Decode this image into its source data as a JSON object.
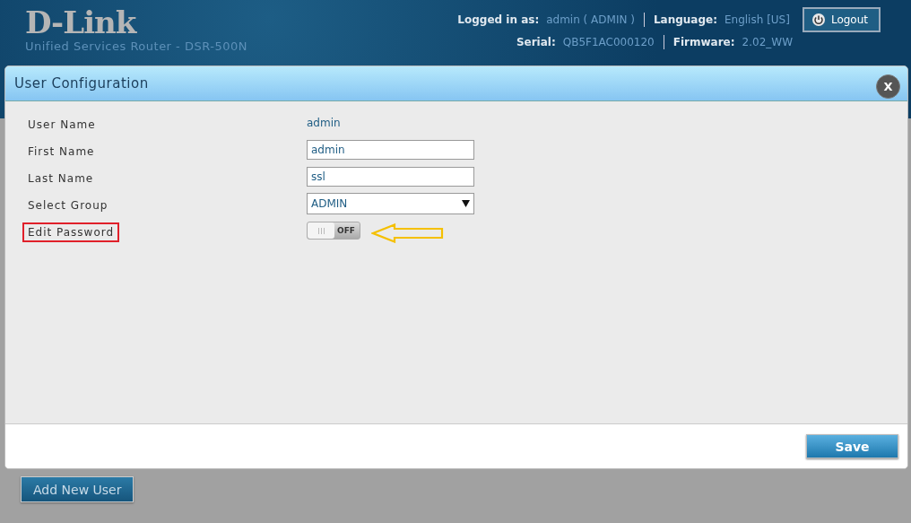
{
  "header": {
    "logo": "D-Link",
    "subtitle": "Unified Services Router - DSR-500N",
    "logged_in_label": "Logged in as:",
    "logged_in_value": "admin ( ADMIN )",
    "language_label": "Language:",
    "language_value": "English [US]",
    "serial_label": "Serial:",
    "serial_value": "QB5F1AC000120",
    "firmware_label": "Firmware:",
    "firmware_value": "2.02_WW",
    "logout": "Logout"
  },
  "dialog": {
    "title": "User Configuration",
    "close": "X",
    "fields": [
      {
        "kind": "text",
        "label": "User Name",
        "value": "admin",
        "highlighted": false
      },
      {
        "kind": "input",
        "label": "First Name",
        "value": "admin",
        "highlighted": false
      },
      {
        "kind": "input",
        "label": "Last Name",
        "value": "ssl",
        "highlighted": false
      },
      {
        "kind": "select",
        "label": "Select Group",
        "value": "ADMIN",
        "highlighted": false
      },
      {
        "kind": "toggle",
        "label": "Edit Password",
        "on": false,
        "off_text": "OFF",
        "highlighted": true
      }
    ],
    "save": "Save"
  },
  "add_new_user": "Add New User"
}
